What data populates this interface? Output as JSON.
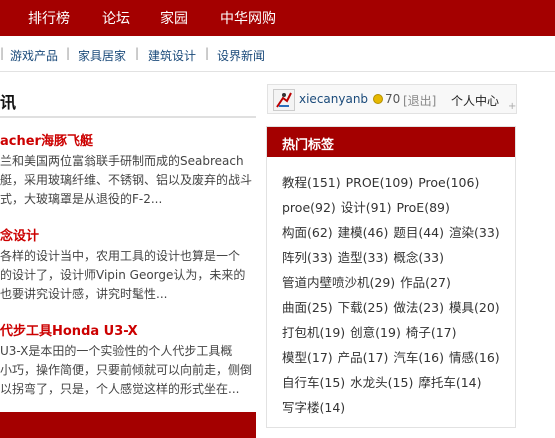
{
  "topnav": {
    "items": [
      "排行榜",
      "论坛",
      "家园",
      "中华网购"
    ]
  },
  "subnav": {
    "items": [
      "游戏产品",
      "家具居家",
      "建筑设计",
      "设界新闻"
    ],
    "separator": "|"
  },
  "news": {
    "heading": "讯",
    "articles": [
      {
        "title": "acher海豚飞艇",
        "lines": [
          "兰和美国两位富翁联手研制而成的Seabreach",
          "艇，采用玻璃纤维、不锈钢、铝以及废弃的战斗",
          "式，大玻璃罩是从退役的F-2..."
        ]
      },
      {
        "title": "念设计",
        "lines": [
          "各样的设计当中，农用工具的设计也算是一个",
          "的设计了，设计师Vipin George认为，未来的",
          "也要讲究设计感，讲究时髦性..."
        ]
      },
      {
        "title": "代步工具Honda U3-X",
        "lines": [
          "U3-X是本田的一个实验性的个人代步工具概",
          "小巧，操作简便，只要前倾就可以向前走，侧倒",
          "以拐弯了，只是，个人感觉这样的形式坐在..."
        ]
      }
    ]
  },
  "user": {
    "name": "xiecanyanb",
    "points": "70",
    "logout": "[退出]",
    "center": "个人中心",
    "plus": "+"
  },
  "hot_tags": {
    "title": "热门标签",
    "rows": [
      [
        "教程(151)",
        "PROE(109)",
        "Proe(106)"
      ],
      [
        "proe(92)",
        "设计(91)",
        "ProE(89)"
      ],
      [
        "构面(62)",
        "建模(46)",
        "题目(44)",
        "渲染(33)"
      ],
      [
        "阵列(33)",
        "造型(33)",
        "概念(33)"
      ],
      [
        "管道内壁喷沙机(29)",
        "作品(27)"
      ],
      [
        "曲面(25)",
        "下载(25)",
        "做法(23)",
        "模具(20)"
      ],
      [
        "打包机(19)",
        "创意(19)",
        "椅子(17)"
      ],
      [
        "模型(17)",
        "产品(17)",
        "汽车(16)",
        "情感(16)"
      ],
      [
        "自行车(15)",
        "水龙头(15)",
        "摩托车(14)"
      ],
      [
        "写字楼(14)"
      ]
    ]
  },
  "colors": {
    "brand_red": "#a40000",
    "link_blue": "#1a4a7a",
    "title_red": "#cc0000"
  }
}
